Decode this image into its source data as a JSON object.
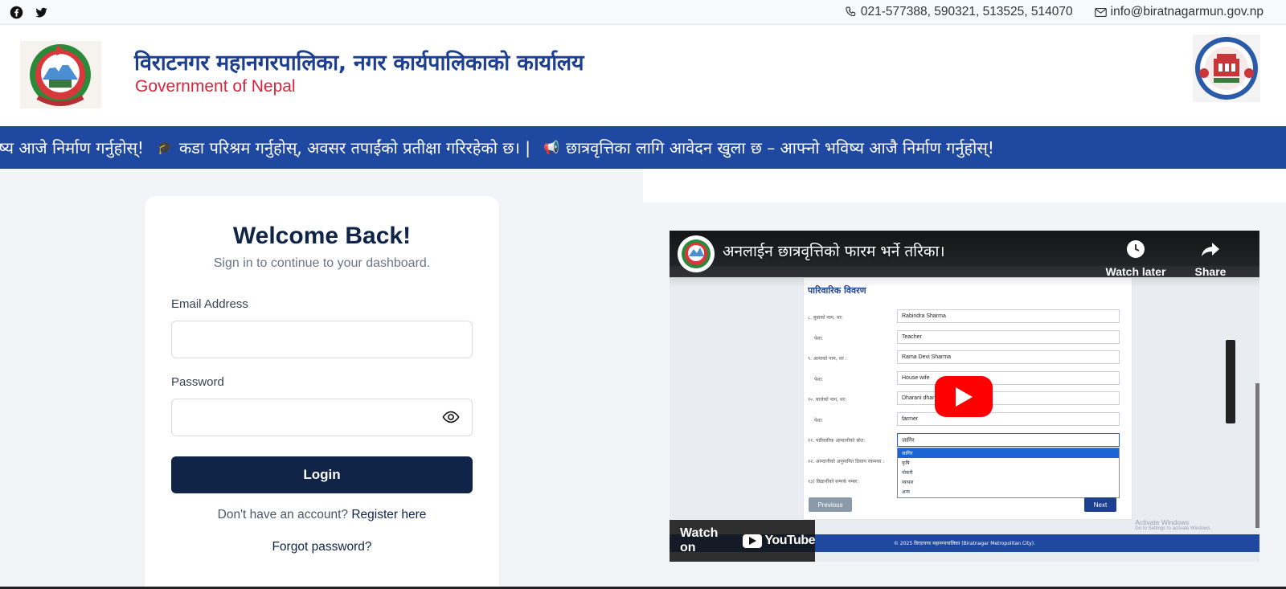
{
  "topbar": {
    "social": [
      "facebook-icon",
      "twitter-icon"
    ],
    "phone": "021-577388, 590321, 513525, 514070",
    "email": "info@biratnagarmun.gov.np"
  },
  "header": {
    "title_ne": "विराटनगर महानगरपालिका, नगर कार्यपालिकाको कार्यालय",
    "title_en": "Government of Nepal"
  },
  "ticker": {
    "items": [
      "विष्य आजे निर्माण गर्नुहोस्!",
      "कडा परिश्रम गर्नुहोस्, अवसर तपाईंको प्रतीक्षा गरिरहेको छ। |",
      "छात्रवृत्तिका लागि आवेदन खुला छ – आफ्नो भविष्य आजै निर्माण गर्नुहोस्!"
    ]
  },
  "login": {
    "title": "Welcome Back!",
    "subtitle": "Sign in to continue to your dashboard.",
    "email_label": "Email Address",
    "email_value": "",
    "password_label": "Password",
    "password_value": "",
    "button": "Login",
    "no_account": "Don't have an account?",
    "register": "Register here",
    "forgot": "Forgot password?"
  },
  "video": {
    "title": "अनलाईन छात्रवृत्तिको फारम भर्ने तरिका।",
    "watch_later": "Watch later",
    "share": "Share",
    "watch_on": "Watch on",
    "youtube": "YouTube",
    "form": {
      "section": "पारिवारिक विवरण",
      "rows": [
        {
          "label": "८. बुबाको नाम, थर:",
          "value": "Rabindra Sharma"
        },
        {
          "label": "पेशा:",
          "value": "Teacher"
        },
        {
          "label": "९. आमाको नाम, थर :",
          "value": "Rama Devi Sharma"
        },
        {
          "label": "पेशा:",
          "value": "House wife"
        },
        {
          "label": "१०. बाजेको नाम, थर:",
          "value": "Dharani dhar"
        },
        {
          "label": "पेशा:",
          "value": "farmer"
        },
        {
          "label": "११. पारिवारिक आम्दानीको स्रोत:",
          "value": "जागिर"
        }
      ],
      "extra_labels": [
        "१२. आम्दानीको अनुमानित डिसाप रकमका :",
        "१३) विद्यार्थीको सम्पर्क नम्बर:"
      ],
      "options": [
        "जागिर",
        "कृषि",
        "नोकरी",
        "व्यापार",
        "अन्य"
      ],
      "previous": "Previous",
      "next": "Next",
      "footer": "© 2025 विराटनगर महानगरपालिका (Biratnagar Metropolitan City).",
      "activate_1": "Activate Windows",
      "activate_2": "Go to Settings to activate Windows."
    }
  }
}
